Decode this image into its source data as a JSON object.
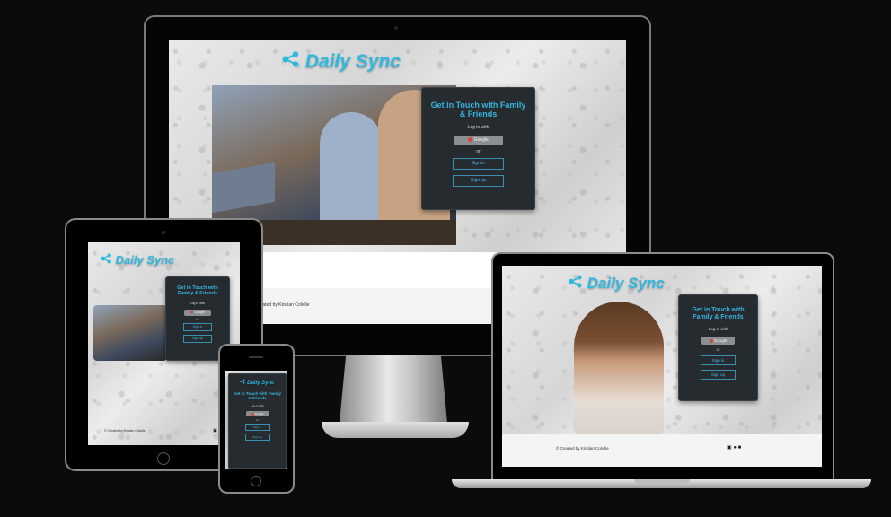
{
  "brand": {
    "name": "Daily Sync",
    "accent": "#2fb8e0",
    "icon": "share-icon"
  },
  "card": {
    "title": "Get in Touch with Family & Friends",
    "login_prompt": "Log in with",
    "google_label": "Google",
    "or_label": "or",
    "signin_label": "Sign in",
    "signup_label": "Sign up"
  },
  "footer": {
    "credit_full": "© Created by Kristian Colville",
    "credit_monitor": "reated by Kristian Colville",
    "social_icons": [
      "badge-icon",
      "github-icon",
      "linkedin-icon"
    ]
  },
  "colors": {
    "card_bg": "#262b30",
    "card_title": "#38b4dc",
    "button_border": "#3b8fb0",
    "background": "#0b0b0b"
  }
}
